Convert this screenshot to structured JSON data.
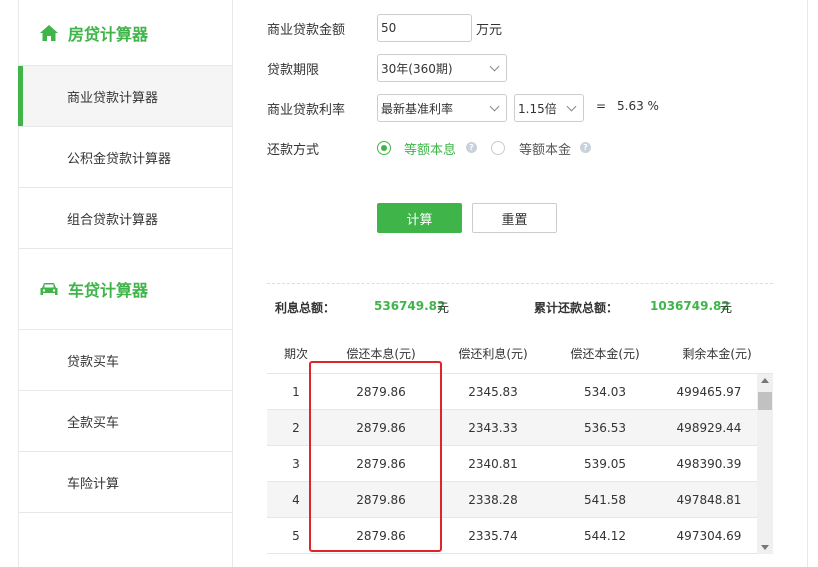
{
  "sidebar": {
    "mortgage_title": "房贷计算器",
    "mortgage_items": [
      {
        "label": "商业贷款计算器",
        "active": true
      },
      {
        "label": "公积金贷款计算器",
        "active": false
      },
      {
        "label": "组合贷款计算器",
        "active": false
      }
    ],
    "car_title": "车贷计算器",
    "car_items": [
      {
        "label": "贷款买车"
      },
      {
        "label": "全款买车"
      },
      {
        "label": "车险计算"
      }
    ]
  },
  "form": {
    "amount_label": "商业贷款金额",
    "amount_value": "50",
    "amount_unit": "万元",
    "term_label": "贷款期限",
    "term_value": "30年(360期)",
    "rate_label": "商业贷款利率",
    "rate_type_value": "最新基准利率",
    "rate_multiplier_value": "1.15倍",
    "equals": "=",
    "rate_result": "5.63 %",
    "repay_label": "还款方式",
    "repay_option1": "等额本息",
    "repay_option2": "等额本金",
    "help_glyph": "?",
    "calc_button": "计算",
    "reset_button": "重置"
  },
  "summary": {
    "interest_label": "利息总额：",
    "interest_value": "536749.82",
    "interest_unit": "元",
    "total_label": "累计还款总额：",
    "total_value": "1036749.82",
    "total_unit": "元"
  },
  "table": {
    "headers": [
      "期次",
      "偿还本息(元)",
      "偿还利息(元)",
      "偿还本金(元)",
      "剩余本金(元)"
    ],
    "rows": [
      [
        "1",
        "2879.86",
        "2345.83",
        "534.03",
        "499465.97"
      ],
      [
        "2",
        "2879.86",
        "2343.33",
        "536.53",
        "498929.44"
      ],
      [
        "3",
        "2879.86",
        "2340.81",
        "539.05",
        "498390.39"
      ],
      [
        "4",
        "2879.86",
        "2338.28",
        "541.58",
        "497848.81"
      ],
      [
        "5",
        "2879.86",
        "2335.74",
        "544.12",
        "497304.69"
      ]
    ]
  },
  "colors": {
    "accent": "#3fb549",
    "highlight": "#e0242b"
  }
}
